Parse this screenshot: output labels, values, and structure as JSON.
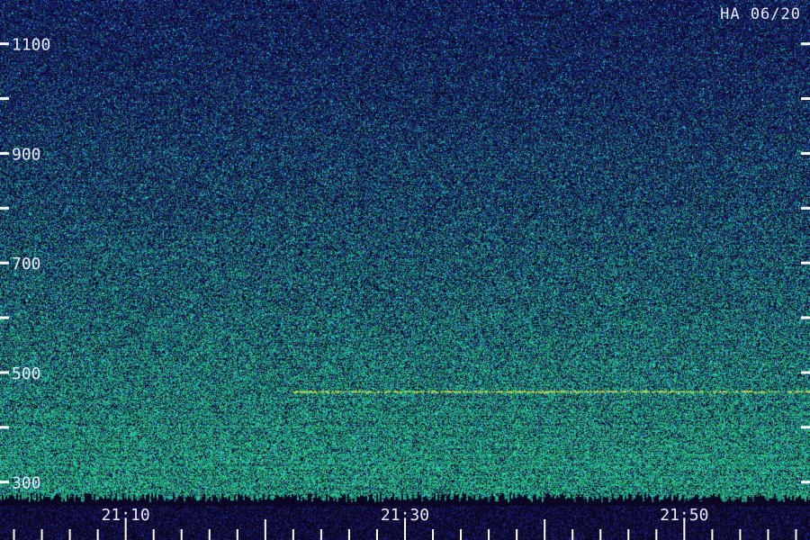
{
  "station_label": "HA 06/20",
  "colors": {
    "background": "#0a0624",
    "noise_low": "#1a1f8a",
    "noise_high": "#34f0a0",
    "tick": "#ffffff",
    "text": "#e8e8ff",
    "signal_line": "#d6e650"
  },
  "chart_data": {
    "type": "heatmap",
    "title": "",
    "xlabel": "",
    "ylabel": "",
    "y_ticks": [
      300,
      500,
      700,
      900,
      1100
    ],
    "y_minor_ticks": [
      400,
      600,
      800,
      1000
    ],
    "ylim": [
      260,
      1180
    ],
    "x_ticks": [
      "21:10",
      "21:30",
      "21:50"
    ],
    "x_start": "21:01",
    "x_end": "21:59",
    "x_minor_step_minutes": 2,
    "x_major_step_minutes": 10,
    "features": [
      {
        "kind": "horizontal_line",
        "frequency": 465,
        "from": "21:22",
        "to": "21:59"
      }
    ],
    "grid": false,
    "legend": "none"
  }
}
